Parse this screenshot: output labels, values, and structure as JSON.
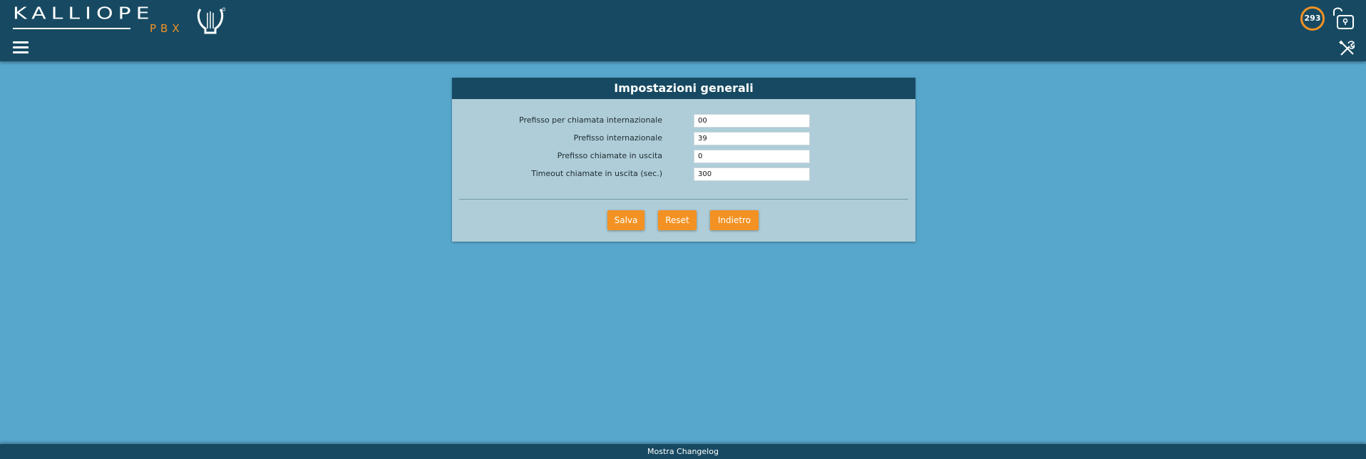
{
  "header": {
    "logo_text": "KALLIOPE",
    "logo_sub": "PBX",
    "counter": "293",
    "menu_icon": "hamburger-menu-icon",
    "lock_icon": "unlocked-padlock-icon",
    "tools_icon": "tools-icon"
  },
  "colors": {
    "header_bg": "#174a62",
    "page_bg": "#57a7cd",
    "panel_bg": "#aecdd8",
    "accent": "#f39223"
  },
  "panel": {
    "title": "Impostazioni generali",
    "fields": [
      {
        "label": "Prefisso per chiamata internazionale",
        "value": "00"
      },
      {
        "label": "Prefisso internazionale",
        "value": "39"
      },
      {
        "label": "Prefisso chiamate in uscita",
        "value": "0"
      },
      {
        "label": "Timeout chiamate in uscita (sec.)",
        "value": "300"
      }
    ],
    "buttons": {
      "save": "Salva",
      "reset": "Reset",
      "back": "Indietro"
    }
  },
  "footer": {
    "changelog": "Mostra Changelog"
  }
}
